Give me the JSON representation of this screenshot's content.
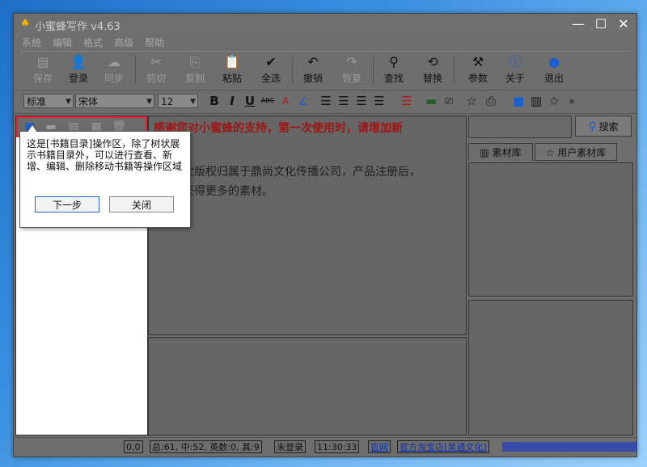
{
  "window": {
    "title": "小蜜蜂写作 v4.63",
    "controls": [
      "—",
      "☐",
      "✕"
    ]
  },
  "menu": [
    "系统",
    "编辑",
    "格式",
    "高级",
    "帮助"
  ],
  "toolbar": [
    {
      "label": "保存",
      "icon": "▤",
      "name": "save"
    },
    {
      "label": "登录",
      "icon": "👤",
      "name": "login"
    },
    {
      "label": "同步",
      "icon": "☁",
      "name": "sync"
    },
    {
      "label": "剪切",
      "icon": "✂",
      "name": "cut"
    },
    {
      "label": "复制",
      "icon": "⎘",
      "name": "copy"
    },
    {
      "label": "粘贴",
      "icon": "📋",
      "name": "paste"
    },
    {
      "label": "全选",
      "icon": "✔",
      "name": "select-all"
    },
    {
      "label": "撤销",
      "icon": "↶",
      "name": "undo"
    },
    {
      "label": "恢复",
      "icon": "↷",
      "name": "redo"
    },
    {
      "label": "查找",
      "icon": "⚲",
      "name": "find"
    },
    {
      "label": "替换",
      "icon": "⟲",
      "name": "replace"
    },
    {
      "label": "参数",
      "icon": "⚒",
      "name": "settings"
    },
    {
      "label": "关于",
      "icon": "ⓘ",
      "name": "about"
    },
    {
      "label": "退出",
      "icon": "●",
      "name": "exit"
    }
  ],
  "format": {
    "style": "标准",
    "font": "宋体",
    "size": "12"
  },
  "editor": {
    "line1": "感谢您对小蜜蜂的支持，第一次使用时，请增加新",
    "line2": "次版权归属于鼎尚文化传播公司，产品注册后，",
    "line3": "获得更多的素材。"
  },
  "right": {
    "search_label": "搜索",
    "tab1": "素材库",
    "tab2": "用户素材库"
  },
  "status": {
    "pos": "0,0",
    "counts": "总:61, 中:52, 英数:0, 其:9",
    "login": "未登录",
    "time": "11:30:33",
    "site": "官网",
    "shop": "官方淘宝店[昊通文化]"
  },
  "tooltip": {
    "text": "这是[书籍目录]操作区，除了树状展示书籍目录外，可以进行查看、新增、编辑、删除移动书籍等操作区域",
    "next": "下一步",
    "close": "关闭"
  }
}
